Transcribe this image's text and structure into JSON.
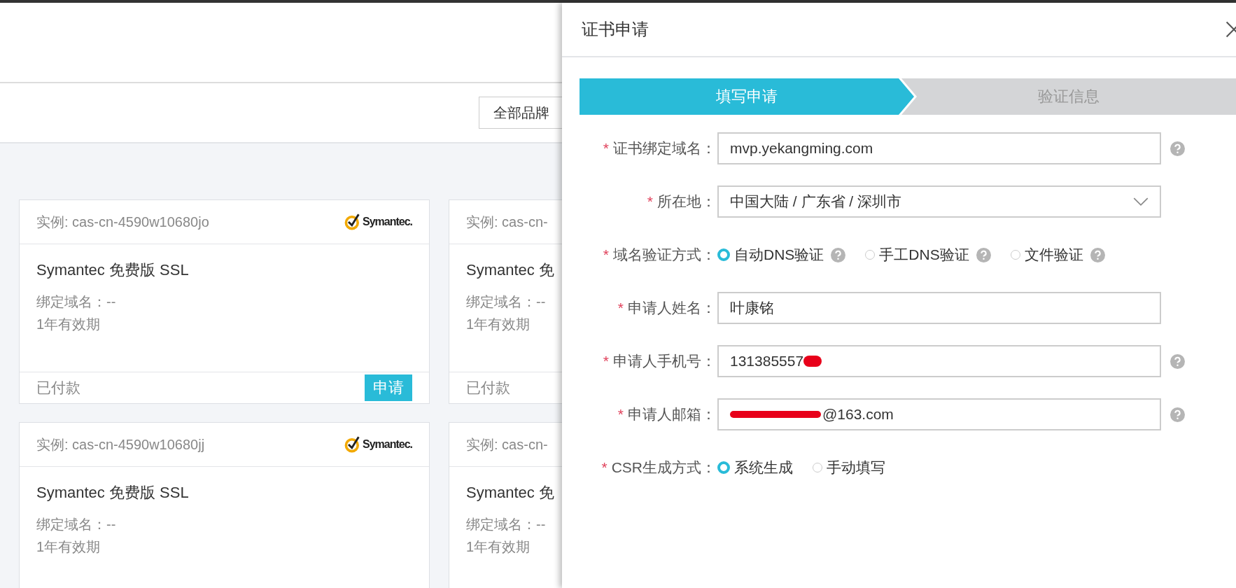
{
  "filter": {
    "brand_dropdown": "全部品牌"
  },
  "cards": [
    {
      "instance": "实例: cas-cn-4590w10680jo",
      "logo_text": "Symantec.",
      "product": "Symantec 免费版 SSL",
      "domain": "绑定域名：--",
      "validity": "1年有效期",
      "status": "已付款",
      "action": "申请"
    },
    {
      "instance": "实例: cas-cn-",
      "product": "Symantec 免",
      "domain": "绑定域名：--",
      "validity": "1年有效期",
      "status": "已付款"
    },
    {
      "instance": "实例: cas-cn-4590w10680jj",
      "logo_text": "Symantec.",
      "product": "Symantec 免费版 SSL",
      "domain": "绑定域名：--",
      "validity": "1年有效期"
    },
    {
      "instance": "实例: cas-cn-",
      "product": "Symantec 免",
      "domain": "绑定域名：--",
      "validity": "1年有效期"
    }
  ],
  "dialog": {
    "title": "证书申请",
    "steps": [
      {
        "label": "填写申请",
        "selected": true
      },
      {
        "label": "验证信息",
        "selected": false
      }
    ],
    "fields": [
      {
        "kind": "text",
        "required_mark": "*",
        "label": "证书绑定域名：",
        "value": "mvp.yekangming.com",
        "help": true
      },
      {
        "kind": "select",
        "required_mark": "*",
        "label": "所在地：",
        "value": "中国大陆 / 广东省 / 深圳市",
        "help": false
      },
      {
        "kind": "radio",
        "required_mark": "*",
        "label": "域名验证方式：",
        "options": [
          {
            "label": "自动DNS验证",
            "selected": true,
            "help": true
          },
          {
            "label": "手工DNS验证",
            "selected": false,
            "help": true
          },
          {
            "label": "文件验证",
            "selected": false,
            "help": true
          }
        ]
      },
      {
        "kind": "text",
        "required_mark": "*",
        "label": "申请人姓名：",
        "value": "叶康铭",
        "help": false
      },
      {
        "kind": "redacted",
        "required_mark": "*",
        "label": "申请人手机号：",
        "value_before": "131385557",
        "help": true
      },
      {
        "kind": "redacted",
        "required_mark": "*",
        "label": "申请人邮箱：",
        "value_after": "@163.com",
        "help": true
      },
      {
        "kind": "radio",
        "required_mark": "*",
        "label": "CSR生成方式：",
        "options": [
          {
            "label": "系统生成",
            "selected": true,
            "help": false
          },
          {
            "label": "手动填写",
            "selected": false,
            "help": false
          }
        ]
      }
    ]
  }
}
